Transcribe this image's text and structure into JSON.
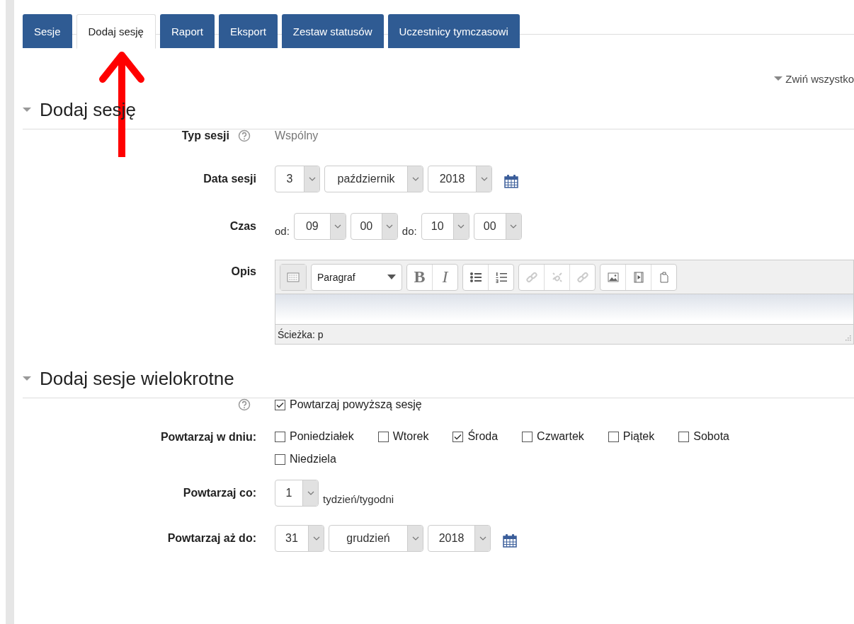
{
  "tabs": [
    {
      "label": "Sesje",
      "selected": false
    },
    {
      "label": "Dodaj sesję",
      "selected": true
    },
    {
      "label": "Raport",
      "selected": false
    },
    {
      "label": "Eksport",
      "selected": false
    },
    {
      "label": "Zestaw statusów",
      "selected": false
    },
    {
      "label": "Uczestnicy tymczasowi",
      "selected": false
    }
  ],
  "collapse_all": "Zwiń wszystko",
  "section_1": {
    "title": "Dodaj sesję",
    "expanded": true,
    "session_type": {
      "label": "Typ sesji",
      "value": "Wspólny"
    },
    "session_date": {
      "label": "Data sesji",
      "selects": [
        "3",
        "październik",
        "2018"
      ]
    },
    "time": {
      "label": "Czas",
      "from_label": "od:",
      "from": [
        "09",
        "00"
      ],
      "to_label": "do:",
      "to": [
        "10",
        "00"
      ]
    },
    "description": {
      "label": "Opis",
      "format": "Paragraf",
      "bold": "B",
      "italic": "I",
      "path": "Ścieżka: p"
    }
  },
  "section_2": {
    "title": "Dodaj sesje wielokrotne",
    "expanded": true,
    "repeat": {
      "label": "Powtarzaj powyższą sesję",
      "checked": true
    },
    "repeat_days": {
      "label": "Powtarzaj w dniu:",
      "days": [
        {
          "label": "Poniedziałek",
          "checked": false
        },
        {
          "label": "Wtorek",
          "checked": false
        },
        {
          "label": "Środa",
          "checked": true
        },
        {
          "label": "Czwartek",
          "checked": false
        },
        {
          "label": "Piątek",
          "checked": false
        },
        {
          "label": "Sobota",
          "checked": false
        },
        {
          "label": "Niedziela",
          "checked": false
        }
      ]
    },
    "repeat_every": {
      "label": "Powtarzaj co:",
      "value": "1",
      "unit": "tydzień/tygodni"
    },
    "repeat_until": {
      "label": "Powtarzaj aż do:",
      "selects": [
        "31",
        "grudzień",
        "2018"
      ]
    }
  }
}
